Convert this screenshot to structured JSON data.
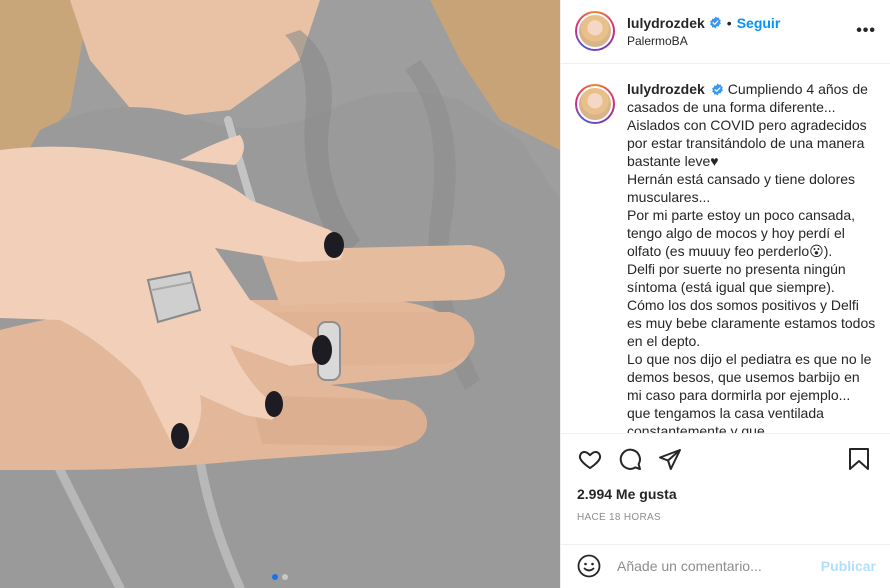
{
  "post": {
    "username": "lulydrozdek",
    "follow_label": "Seguir",
    "separator": "•",
    "location": "PalermoBA",
    "more_label": "•••"
  },
  "caption": {
    "username": "lulydrozdek",
    "lines": [
      "Cumpliendo 4 años de casados de una forma diferente... Aislados con COVID pero agradecidos por estar transitándolo de una manera bastante leve♥",
      "Hernán está cansado y tiene dolores musculares...",
      "Por mi parte estoy un poco cansada, tengo algo de mocos y hoy perdí el olfato (es muuuy feo perderlo😮).",
      "Delfi por suerte no presenta ningún síntoma (está igual que siempre).",
      "Cómo los dos somos positivos y Delfi es muy bebe claramente estamos todos en el depto.",
      "Lo que nos dijo el pediatra es que no le demos besos, que usemos barbijo en mi caso para dormirla por ejemplo... que tengamos la casa ventilada constantemente y que"
    ]
  },
  "stats": {
    "likes": "2.994 Me gusta",
    "time": "HACE 18 HORAS"
  },
  "comment": {
    "placeholder": "Añade un comentario...",
    "publish_label": "Publicar"
  },
  "icons": {
    "heart": "heart-icon",
    "comment": "comment-icon",
    "share": "share-icon",
    "save": "bookmark-icon",
    "emoji": "emoji-icon",
    "verified": "verified-badge-icon"
  },
  "colors": {
    "link": "#0095f6",
    "publish_disabled": "#b2dffc",
    "muted": "#8e8e8e",
    "text": "#262626"
  }
}
